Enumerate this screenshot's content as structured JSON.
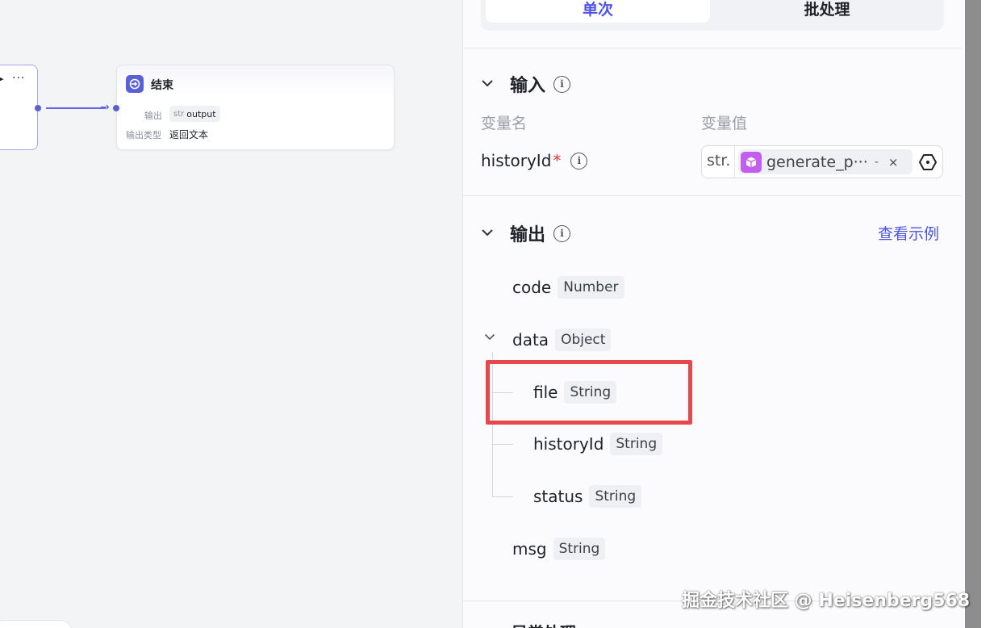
{
  "canvas": {
    "end_node": {
      "title": "结束",
      "output_label": "输出",
      "output_type": "str",
      "output_name": "output",
      "output_type_label": "输出类型",
      "output_type_value": "返回文本"
    }
  },
  "panel": {
    "tabs": [
      {
        "label": "单次",
        "active": true
      },
      {
        "label": "批处理",
        "active": false
      }
    ],
    "input": {
      "title": "输入",
      "col_name": "变量名",
      "col_value": "变量值",
      "var_name": "historyId",
      "required_mark": "*",
      "value_type": "str.",
      "ref_text": "generate_p···",
      "ref_dash": "-",
      "ref_close": "×"
    },
    "output": {
      "title": "输出",
      "example_link": "查看示例",
      "fields": [
        {
          "name": "code",
          "type": "Number"
        },
        {
          "name": "data",
          "type": "Object"
        },
        {
          "name": "file",
          "type": "String"
        },
        {
          "name": "historyId",
          "type": "String"
        },
        {
          "name": "status",
          "type": "String"
        },
        {
          "name": "msg",
          "type": "String"
        }
      ]
    },
    "next_section_title": "异常处理"
  },
  "watermark": "掘金技术社区 @ Heisenberg568",
  "colors": {
    "accent": "#4d53e8",
    "highlight_box": "#e8474b",
    "node_icon": "#5b5fd6",
    "ref_icon": "#c15ef0"
  },
  "icons": [
    "end-node-icon",
    "more-icon",
    "info-icon",
    "chevron-down-icon",
    "cube-icon",
    "hex-settings-icon"
  ]
}
